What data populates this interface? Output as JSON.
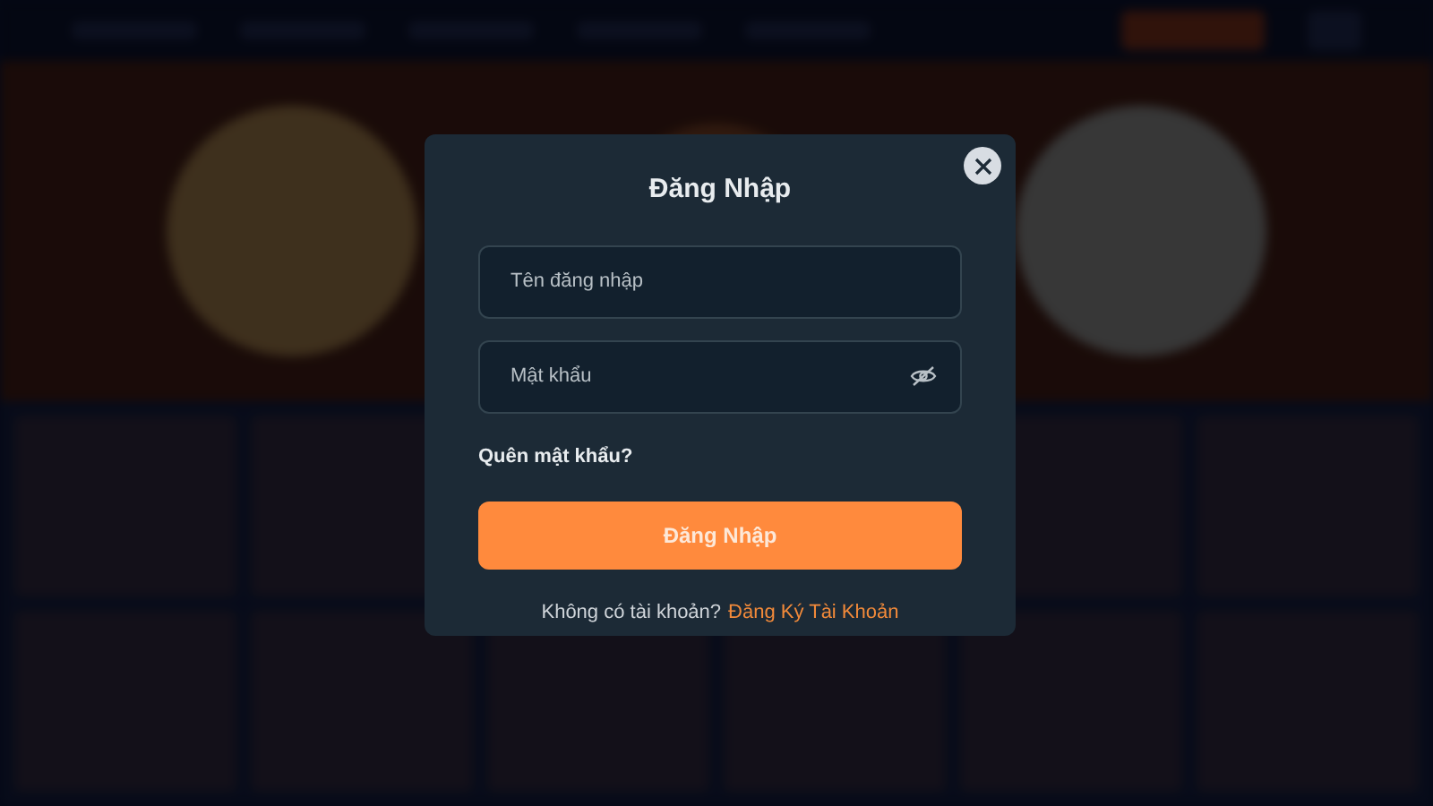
{
  "login_dialog": {
    "title": "Đăng Nhập",
    "username_field": {
      "placeholder": "Tên đăng nhập"
    },
    "password_field": {
      "placeholder": "Mật khẩu"
    },
    "forgot_link": "Quên mật khẩu?",
    "submit_button": "Đăng Nhập",
    "signup_prompt": "Không có tài khoản?",
    "signup_link": "Đăng Ký Tài Khoản"
  }
}
